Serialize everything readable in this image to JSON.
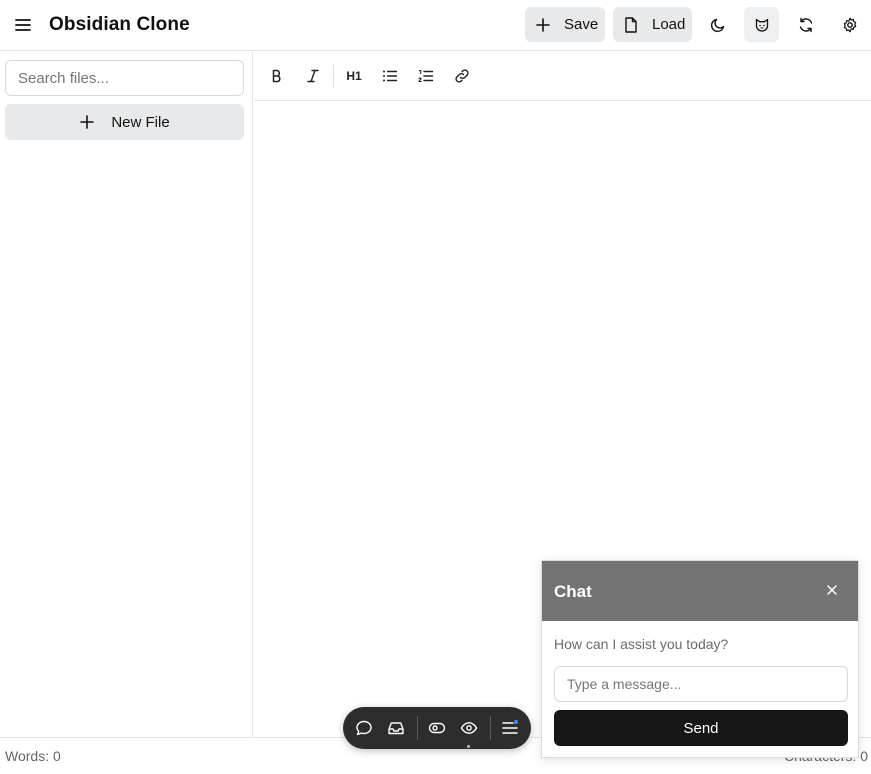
{
  "header": {
    "title": "Obsidian Clone",
    "save_label": "Save",
    "load_label": "Load",
    "icons": [
      "menu-icon",
      "plus-icon",
      "file-icon",
      "moon-icon",
      "cat-icon",
      "refresh-icon",
      "gear-icon"
    ]
  },
  "sidebar": {
    "search_placeholder": "Search files...",
    "new_file_label": "New File"
  },
  "toolbar": {
    "heading_label": "H1",
    "icons": [
      "bold-icon",
      "italic-icon",
      "heading-icon",
      "bullet-list-icon",
      "numbered-list-icon",
      "link-icon"
    ]
  },
  "status": {
    "words": "Words: 0",
    "characters": "Characters: 0"
  },
  "dock": {
    "icons": [
      "chat-bubble-icon",
      "inbox-icon",
      "toggle-icon",
      "eye-icon",
      "menu-icon"
    ]
  },
  "chat": {
    "title": "Chat",
    "close_glyph": "×",
    "message": "How can I assist you today?",
    "input_placeholder": "Type a message...",
    "send_label": "Send"
  },
  "colors": {
    "chat_header": "#737373",
    "send_button": "#171717",
    "dock": "#2d2d2d",
    "button_bg": "#e8e9eb",
    "notification_dot": "#4a8cf0"
  }
}
